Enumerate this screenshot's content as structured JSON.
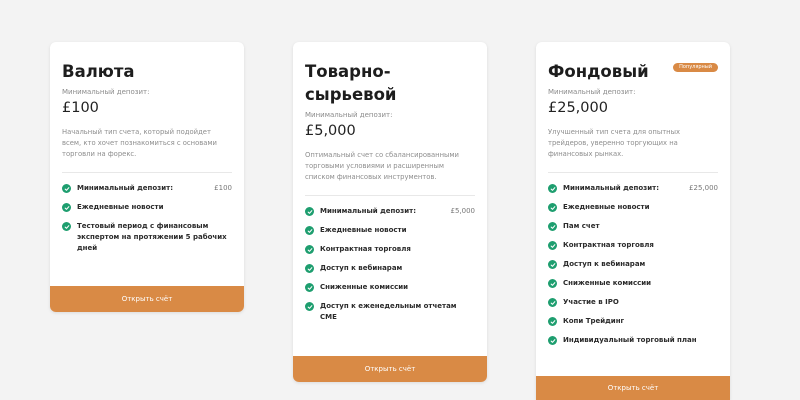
{
  "plans": [
    {
      "title": "Валюта",
      "min_deposit_label": "Минимальный депозит:",
      "price": "£100",
      "description": "Начальный тип счета, который подойдет всем, кто хочет познакомиться с основами торговли на форекс.",
      "features": [
        {
          "label": "Минимальный депозит:",
          "value": "£100"
        },
        {
          "label": "Ежедневные новости"
        },
        {
          "label": "Тестовый период с финансовым экспертом на протяжении 5 рабочих дней"
        }
      ],
      "cta": "Открыть счёт"
    },
    {
      "title": "Товарно-сырьевой",
      "min_deposit_label": "Минимальный депозит:",
      "price": "£5,000",
      "description": "Оптимальный счет со сбалансированными торговыми условиями и расширенным списком финансовых инструментов.",
      "features": [
        {
          "label": "Минимальный депозит:",
          "value": "£5,000"
        },
        {
          "label": "Ежедневные новости"
        },
        {
          "label": "Контрактная торговля"
        },
        {
          "label": "Доступ к вебинарам"
        },
        {
          "label": "Сниженные комиссии"
        },
        {
          "label": "Доступ к еженедельным отчетам CME"
        }
      ],
      "cta": "Открыть счёт"
    },
    {
      "title": "Фондовый",
      "badge": "Популярный",
      "min_deposit_label": "Минимальный депозит:",
      "price": "£25,000",
      "description": "Улучшенный тип счета для опытных трейдеров, уверенно торгующих на финансовых рынках.",
      "features": [
        {
          "label": "Минимальный депозит:",
          "value": "£25,000"
        },
        {
          "label": "Ежедневные новости"
        },
        {
          "label": "Пам счет"
        },
        {
          "label": "Контрактная торговля"
        },
        {
          "label": "Доступ к вебинарам"
        },
        {
          "label": "Сниженные комиссии"
        },
        {
          "label": "Участие в IPO"
        },
        {
          "label": "Копи Трейдинг"
        },
        {
          "label": "Индивидуальный торговый план"
        }
      ],
      "cta": "Открыть счёт"
    }
  ],
  "icons": {
    "feature_check": "check-circle-icon"
  },
  "colors": {
    "accent": "#d98a45",
    "check": "#1e9e6f",
    "background": "#f3f3f3",
    "card": "#ffffff"
  }
}
